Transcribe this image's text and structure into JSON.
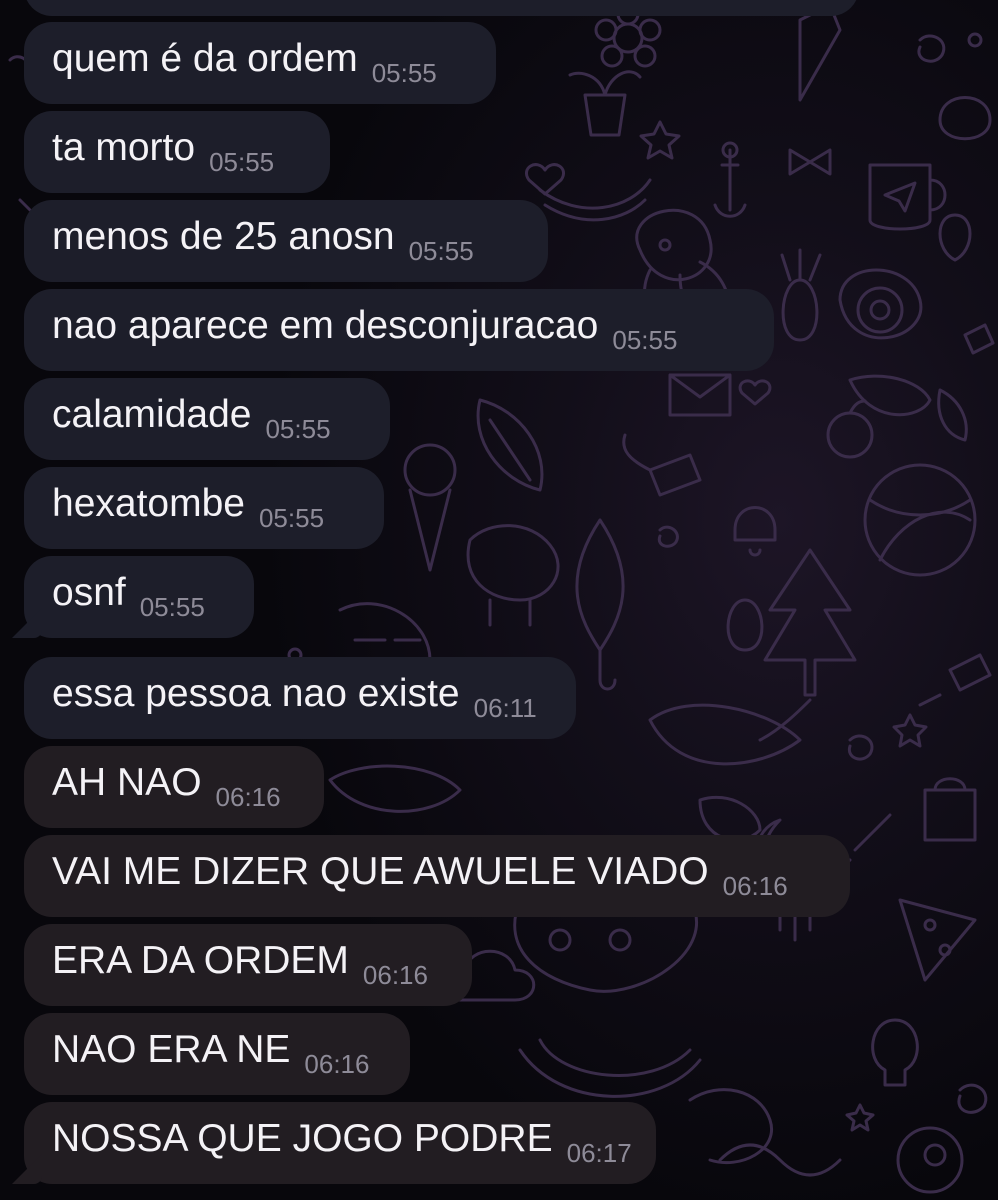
{
  "chat": {
    "messages": [
      {
        "text": "quem é da ordem",
        "time": "05:55"
      },
      {
        "text": "ta morto",
        "time": "05:55"
      },
      {
        "text": "menos de 25 anosn",
        "time": "05:55"
      },
      {
        "text": "nao aparece em desconjuracao",
        "time": "05:55"
      },
      {
        "text": "calamidade",
        "time": "05:55"
      },
      {
        "text": "hexatombe",
        "time": "05:55"
      },
      {
        "text": "osnf",
        "time": "05:55"
      },
      {
        "text": "essa pessoa nao existe",
        "time": "06:11"
      },
      {
        "text": "AH NAO",
        "time": "06:16"
      },
      {
        "text": "VAI ME DIZER QUE AWUELE VIADO",
        "time": "06:16"
      },
      {
        "text": "ERA DA ORDEM",
        "time": "06:16"
      },
      {
        "text": "NAO ERA NE",
        "time": "06:16"
      },
      {
        "text": "NOSSA QUE JOGO PODRE",
        "time": "06:17"
      }
    ]
  },
  "colors": {
    "background": "#0a0810",
    "bubble_top": "#1d1e2a",
    "bubble_bottom": "#221d22",
    "text": "#f4f2f6",
    "timestamp": "#8e8b98",
    "doodle": "#3a2c4a"
  }
}
